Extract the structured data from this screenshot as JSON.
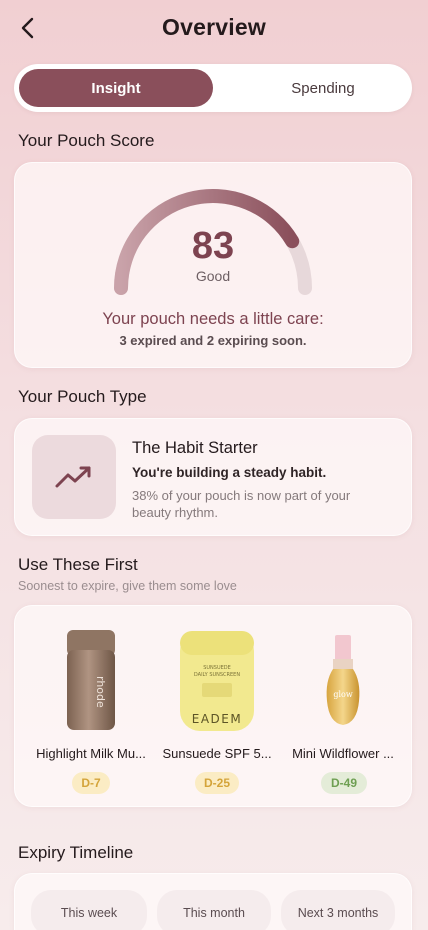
{
  "header": {
    "title": "Overview",
    "back_icon": "chevron-left-icon"
  },
  "tabs": [
    {
      "label": "Insight",
      "active": true
    },
    {
      "label": "Spending",
      "active": false
    }
  ],
  "score_section": {
    "title": "Your Pouch Score",
    "score": "83",
    "score_fraction": 0.83,
    "rating": "Good",
    "message": "Your pouch needs a little care:",
    "detail": "3 expired and 2 expiring soon."
  },
  "type_section": {
    "title": "Your Pouch Type",
    "icon": "trending-up-icon",
    "name": "The Habit Starter",
    "description": "You're building a steady habit.",
    "note": "38% of your pouch is now part of your beauty rhythm."
  },
  "use_first": {
    "title": "Use These First",
    "subtitle": "Soonest to expire, give them some love",
    "products": [
      {
        "name": "Highlight Milk Mu...",
        "badge": "D-7",
        "brand_text": "rhode"
      },
      {
        "name": "Sunsuede SPF 5...",
        "badge": "D-25",
        "brand_text": "EADEM"
      },
      {
        "name": "Mini Wildflower ...",
        "badge": "D-49",
        "brand_text": "glow"
      }
    ]
  },
  "timeline": {
    "title": "Expiry Timeline",
    "tabs": [
      "This week",
      "This month",
      "Next 3 months"
    ]
  },
  "colors": {
    "accent": "#8a4f5b",
    "badge_urgent_bg": "#fbecc4",
    "badge_urgent_text": "#d4a43a",
    "badge_ok_bg": "#e4ecd8",
    "badge_ok_text": "#6e9f52"
  }
}
